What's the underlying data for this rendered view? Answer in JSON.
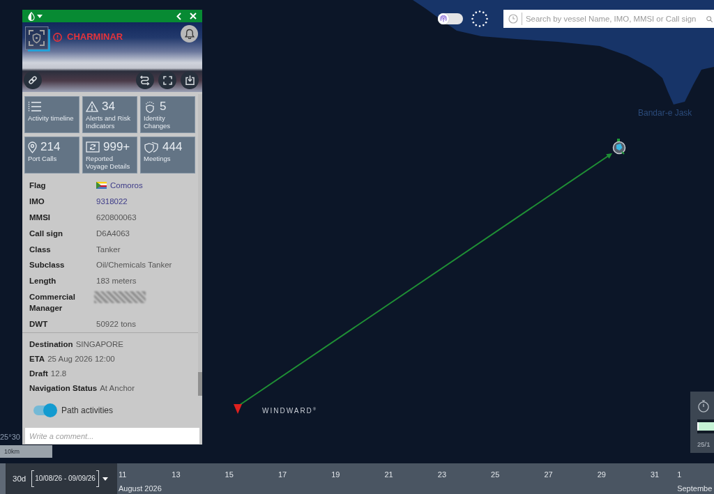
{
  "map": {
    "place_label": "Bandar-e Jask",
    "brand": "WINDWARD$^{®}$",
    "coordinate": "25°30",
    "scale": "10km"
  },
  "toolbar": {
    "layer_toggle": {
      "on": false
    },
    "search": {
      "placeholder": "Search by vessel Name, IMO, MMSI or Call sign"
    }
  },
  "vessel_panel": {
    "name": "CHARMINAR",
    "tiles": [
      {
        "label": "Activity timeline"
      },
      {
        "count": "34",
        "label": "Alerts and Risk Indicators"
      },
      {
        "count": "5",
        "label": "Identity Changes"
      },
      {
        "count": "214",
        "label": "Port Calls"
      },
      {
        "count": "999+",
        "label": "Reported Voyage Details"
      },
      {
        "count": "444",
        "label": "Meetings"
      }
    ],
    "details": [
      {
        "kind": "flag",
        "label": "Flag",
        "value": "Comoros"
      },
      {
        "kind": "link",
        "label": "IMO",
        "value": "9318022"
      },
      {
        "kind": "text",
        "label": "MMSI",
        "value": "620800063"
      },
      {
        "kind": "text",
        "label": "Call sign",
        "value": "D6A4063"
      },
      {
        "kind": "text",
        "label": "Class",
        "value": "Tanker"
      },
      {
        "kind": "text",
        "label": "Subclass",
        "value": "Oil/Chemicals Tanker"
      },
      {
        "kind": "text",
        "label": "Length",
        "value": "183 meters"
      },
      {
        "kind": "redacted",
        "label": "Commercial Manager"
      },
      {
        "kind": "text",
        "label": "DWT",
        "value": "50922 tons"
      }
    ],
    "voyage": [
      {
        "label": "Destination",
        "value": "SINGAPORE"
      },
      {
        "label": "ETA",
        "value": "25 Aug 2026 12:00"
      },
      {
        "label": "Draft",
        "value": "12.8"
      },
      {
        "label": "Navigation Status",
        "value": "At Anchor"
      }
    ],
    "path_activities": {
      "label": "Path activities",
      "on": true
    },
    "comment": {
      "placeholder": "Write a comment..."
    }
  },
  "side_widget": {
    "date": "25/1",
    "progress": {
      "level": 1
    }
  },
  "timeline": {
    "range_length": "30d",
    "range": "10/08/26 - 09/09/26",
    "ticks": [
      {
        "label": "11",
        "month": "August 2026"
      },
      {
        "label": "13"
      },
      {
        "label": "15"
      },
      {
        "label": "17"
      },
      {
        "label": "19"
      },
      {
        "label": "21"
      },
      {
        "label": "23"
      },
      {
        "label": "25"
      },
      {
        "label": "27"
      },
      {
        "label": "29"
      },
      {
        "label": "31"
      },
      {
        "label": "1",
        "month": "Septembe"
      }
    ]
  }
}
